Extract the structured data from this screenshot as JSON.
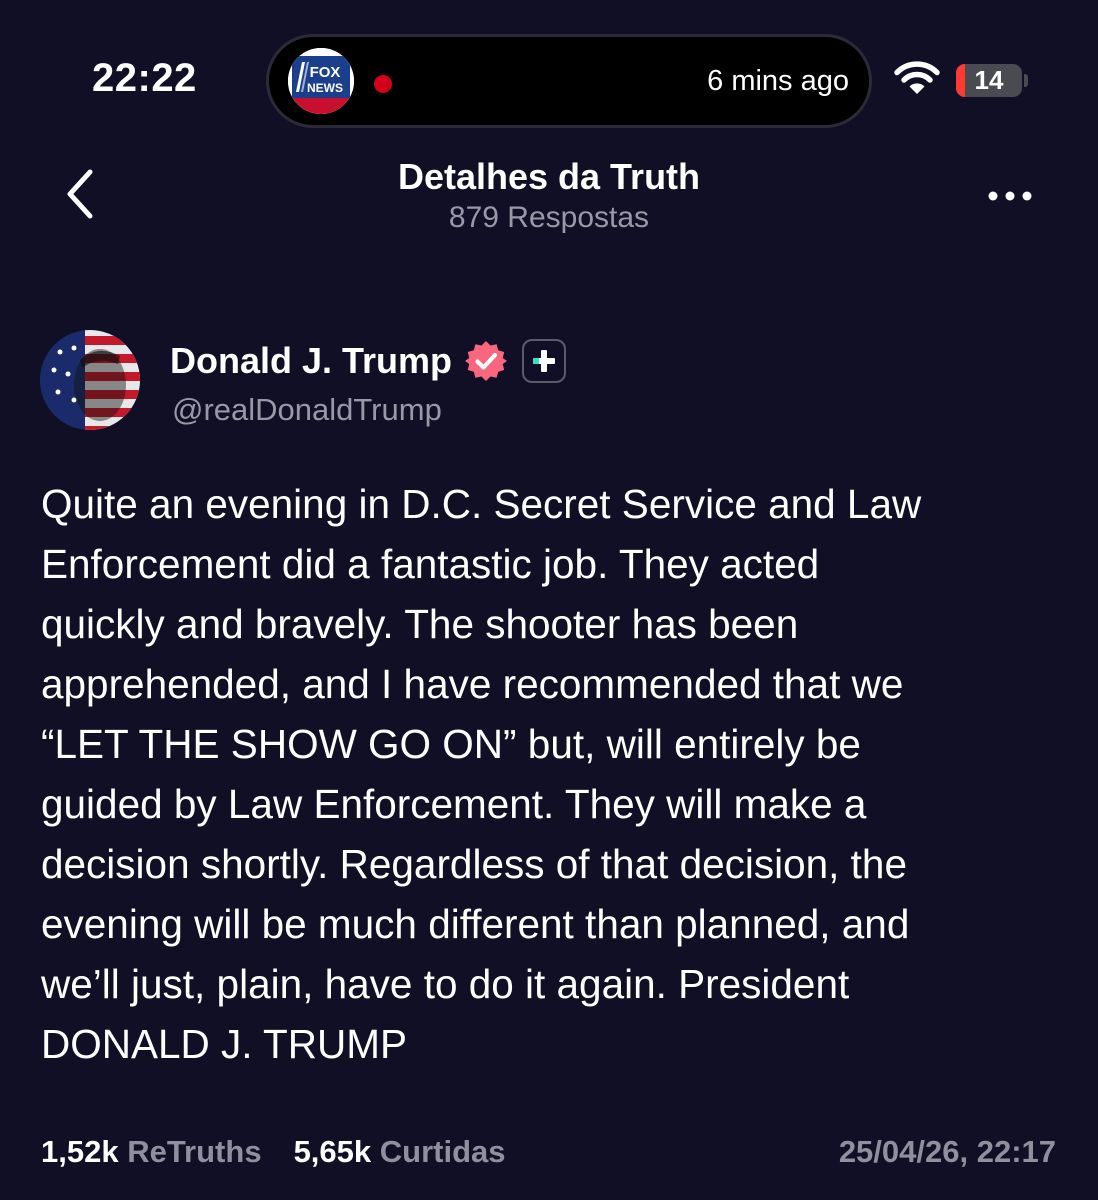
{
  "status_bar": {
    "time": "22:22",
    "live_activity": {
      "source_logo": [
        "FOX",
        "NEWS"
      ],
      "updated": "6 mins ago"
    },
    "battery_level": "14",
    "battery_fraction": 0.14,
    "icons": [
      "wifi-icon",
      "battery-icon",
      "fox-news-logo",
      "live-dot"
    ]
  },
  "header": {
    "title": "Detalhes da Truth",
    "subtitle": "879 Respostas",
    "back_icon": "chevron-left-icon",
    "more_icon": "more-horizontal-icon"
  },
  "post": {
    "author_name": "Donald J. Trump",
    "handle": "@realDonaldTrump",
    "verified_icon": "verified-badge-icon",
    "extra_badge_icon": "plus-badge-icon",
    "text": "Quite an evening in D.C. Secret Service and Law\nEnforcement did a fantastic job. They acted\nquickly and bravely. The shooter has been\napprehended, and I have recommended that we\n“LET THE SHOW GO ON” but, will entirely be\nguided by Law Enforcement. They will make a\ndecision shortly. Regardless of that decision, the\nevening will be much different than planned, and\nwe’ll just, plain, have to do it again. President\nDONALD J. TRUMP",
    "retruths_count": "1,52k",
    "retruths_label": "ReTruths",
    "likes_count": "5,65k",
    "likes_label": "Curtidas",
    "date": "25/04/26, 22:17"
  },
  "colors": {
    "background": "#100f25",
    "muted_text": "#9898a6",
    "verified_badge": "#f9667d",
    "plus_badge_accent": "#2fe3c4",
    "battery_low": "#ff3b30",
    "live_dot": "#d3001a"
  }
}
